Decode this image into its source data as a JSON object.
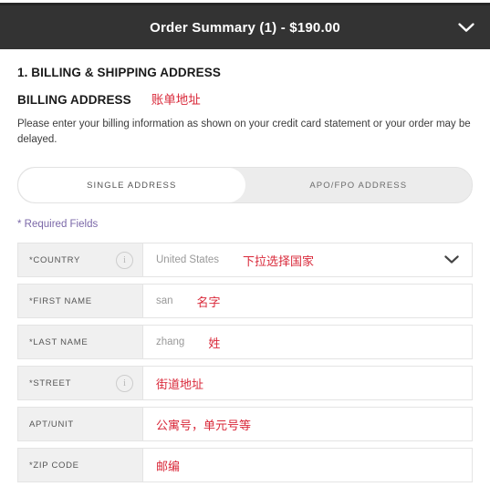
{
  "order_header": {
    "title": "Order Summary (1) - $190.00",
    "chevron_icon": "chevron-down-icon"
  },
  "billing": {
    "section_title": "1. BILLING & SHIPPING ADDRESS",
    "subsection_title": "BILLING ADDRESS",
    "subsection_annotation": "账单地址",
    "help_text": "Please enter your billing information as shown on your credit card statement or your order may be delayed.",
    "required_note": "* Required Fields"
  },
  "address_toggle": {
    "tabs": [
      {
        "label": "SINGLE ADDRESS",
        "active": true
      },
      {
        "label": "APO/FPO ADDRESS",
        "active": false
      }
    ]
  },
  "form": {
    "rows": [
      {
        "label": "*COUNTRY",
        "has_info_icon": true,
        "value": "United States",
        "annotation": "下拉选择国家",
        "is_select": true
      },
      {
        "label": "*FIRST NAME",
        "has_info_icon": false,
        "value": "san",
        "annotation": "名字",
        "is_select": false
      },
      {
        "label": "*LAST NAME",
        "has_info_icon": false,
        "value": "zhang",
        "annotation": "姓",
        "is_select": false
      },
      {
        "label": "*STREET",
        "has_info_icon": true,
        "value": "",
        "annotation": "街道地址",
        "is_select": false
      },
      {
        "label": "APT/UNIT",
        "has_info_icon": false,
        "value": "",
        "annotation": "公寓号，单元号等",
        "is_select": false
      },
      {
        "label": "*ZIP CODE",
        "has_info_icon": false,
        "value": "",
        "annotation": "邮编",
        "is_select": false
      }
    ]
  },
  "colors": {
    "header_bg": "#333333",
    "annotation_red": "#d9293a",
    "required_purple": "#7b68a8",
    "label_cell_bg": "#f0f0f0"
  }
}
